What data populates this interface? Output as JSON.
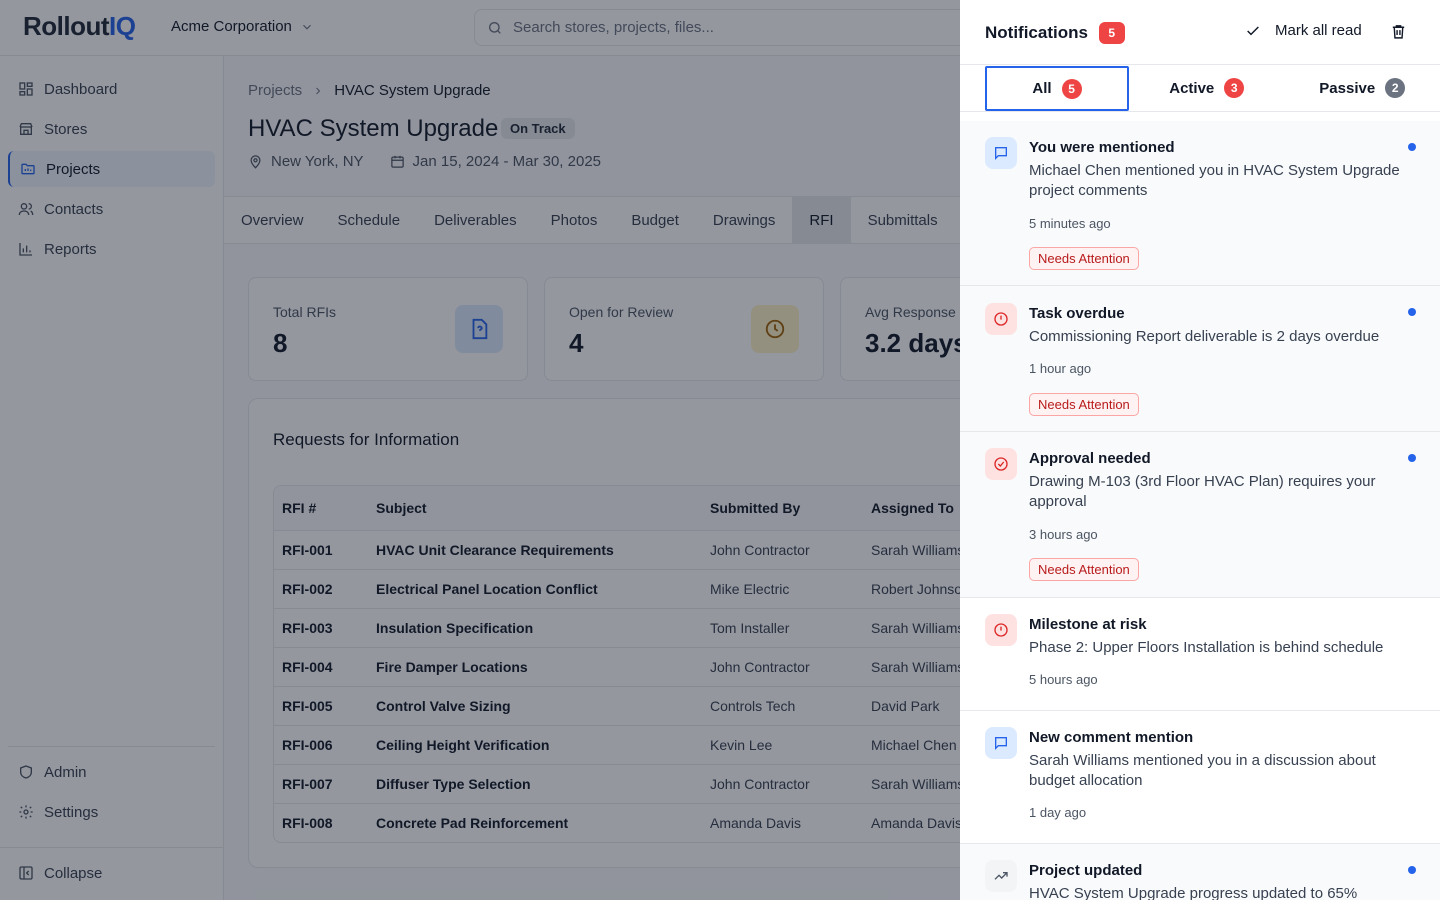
{
  "app": {
    "logo_main": "Rollout",
    "logo_accent": "IQ",
    "org": "Acme Corporation"
  },
  "search": {
    "placeholder": "Search stores, projects, files..."
  },
  "sidebar": {
    "items": [
      {
        "label": "Dashboard"
      },
      {
        "label": "Stores"
      },
      {
        "label": "Projects"
      },
      {
        "label": "Contacts"
      },
      {
        "label": "Reports"
      }
    ],
    "bottom": [
      {
        "label": "Admin"
      },
      {
        "label": "Settings"
      }
    ],
    "collapse": "Collapse"
  },
  "project": {
    "breadcrumb_parent": "Projects",
    "breadcrumb_current": "HVAC System Upgrade",
    "title": "HVAC System Upgrade",
    "status": "On Track",
    "location": "New York, NY",
    "dates": "Jan 15, 2024 - Mar 30, 2025"
  },
  "tabs": [
    "Overview",
    "Schedule",
    "Deliverables",
    "Photos",
    "Budget",
    "Drawings",
    "RFI",
    "Submittals"
  ],
  "stats": [
    {
      "label": "Total RFIs",
      "value": "8"
    },
    {
      "label": "Open for Review",
      "value": "4"
    },
    {
      "label": "Avg Response",
      "value": "3.2 days"
    }
  ],
  "rfi_table": {
    "title": "Requests for Information",
    "headers": [
      "RFI #",
      "Subject",
      "Submitted By",
      "Assigned To"
    ],
    "rows": [
      [
        "RFI-001",
        "HVAC Unit Clearance Requirements",
        "John Contractor",
        "Sarah Williams"
      ],
      [
        "RFI-002",
        "Electrical Panel Location Conflict",
        "Mike Electric",
        "Robert Johnson"
      ],
      [
        "RFI-003",
        "Insulation Specification",
        "Tom Installer",
        "Sarah Williams"
      ],
      [
        "RFI-004",
        "Fire Damper Locations",
        "John Contractor",
        "Sarah Williams"
      ],
      [
        "RFI-005",
        "Control Valve Sizing",
        "Controls Tech",
        "David Park"
      ],
      [
        "RFI-006",
        "Ceiling Height Verification",
        "Kevin Lee",
        "Michael Chen"
      ],
      [
        "RFI-007",
        "Diffuser Type Selection",
        "John Contractor",
        "Sarah Williams"
      ],
      [
        "RFI-008",
        "Concrete Pad Reinforcement",
        "Amanda Davis",
        "Amanda Davis"
      ]
    ]
  },
  "notifications": {
    "title": "Notifications",
    "count": "5",
    "mark_all": "Mark all read",
    "tabs": [
      {
        "label": "All",
        "count": "5"
      },
      {
        "label": "Active",
        "count": "3"
      },
      {
        "label": "Passive",
        "count": "2"
      }
    ],
    "items": [
      {
        "title": "You were mentioned",
        "body": "Michael Chen mentioned you in HVAC System Upgrade project comments",
        "time": "5 minutes ago",
        "badge": "Needs Attention",
        "icon": "message-icon",
        "unread": true
      },
      {
        "title": "Task overdue",
        "body": "Commissioning Report deliverable is 2 days overdue",
        "time": "1 hour ago",
        "badge": "Needs Attention",
        "icon": "alert-circle-icon",
        "unread": true
      },
      {
        "title": "Approval needed",
        "body": "Drawing M-103 (3rd Floor HVAC Plan) requires your approval",
        "time": "3 hours ago",
        "badge": "Needs Attention",
        "icon": "check-circle-icon",
        "unread": true
      },
      {
        "title": "Milestone at risk",
        "body": "Phase 2: Upper Floors Installation is behind schedule",
        "time": "5 hours ago",
        "badge": "",
        "icon": "alert-circle-icon",
        "unread": false
      },
      {
        "title": "New comment mention",
        "body": "Sarah Williams mentioned you in a discussion about budget allocation",
        "time": "1 day ago",
        "badge": "",
        "icon": "message-icon",
        "unread": false
      },
      {
        "title": "Project updated",
        "body": "HVAC System Upgrade progress updated to 65%",
        "time": "",
        "badge": "",
        "icon": "trending-up-icon",
        "unread": true
      }
    ]
  },
  "colors": {
    "accent": "#2563eb",
    "danger": "#ef4444",
    "overlay": "rgba(17,24,39,0.45)"
  }
}
